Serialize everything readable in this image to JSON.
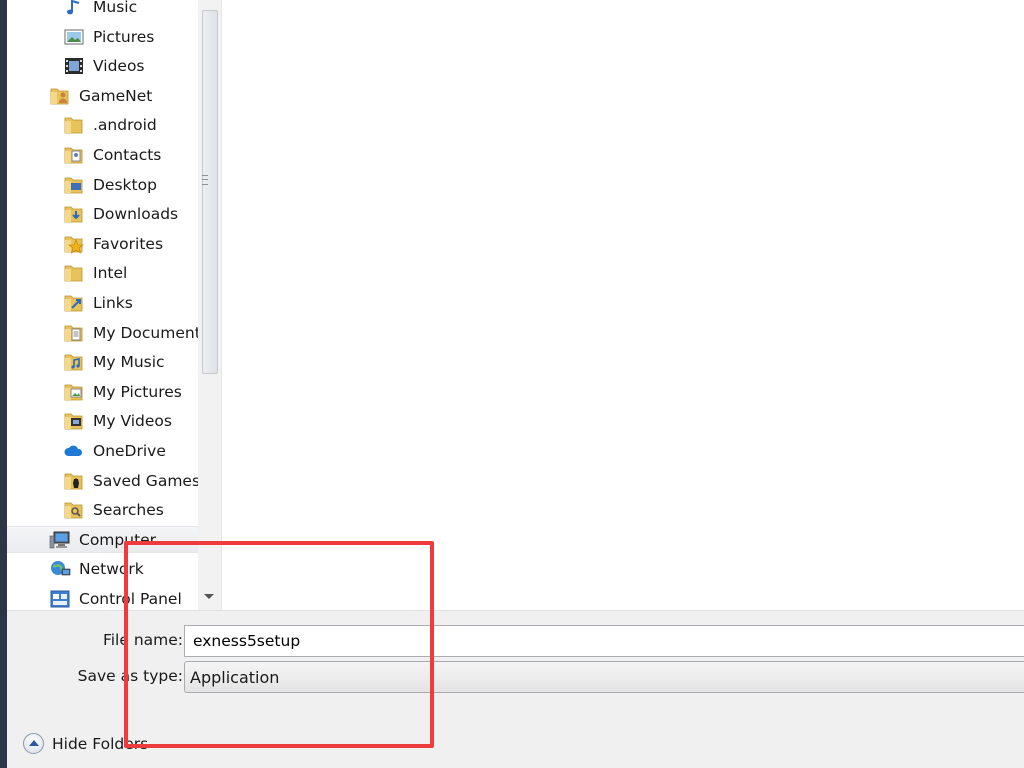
{
  "tree": {
    "items": [
      {
        "label": "Music",
        "icon": "music-library-icon",
        "level": 2,
        "selected": false
      },
      {
        "label": "Pictures",
        "icon": "pictures-library-icon",
        "level": 2,
        "selected": false
      },
      {
        "label": "Videos",
        "icon": "videos-library-icon",
        "level": 2,
        "selected": false
      },
      {
        "label": "GameNet",
        "icon": "user-folder-icon",
        "level": 1,
        "selected": false
      },
      {
        "label": ".android",
        "icon": "folder-icon",
        "level": 2,
        "selected": false
      },
      {
        "label": "Contacts",
        "icon": "contacts-folder-icon",
        "level": 2,
        "selected": false
      },
      {
        "label": "Desktop",
        "icon": "desktop-folder-icon",
        "level": 2,
        "selected": false
      },
      {
        "label": "Downloads",
        "icon": "downloads-folder-icon",
        "level": 2,
        "selected": false
      },
      {
        "label": "Favorites",
        "icon": "favorites-folder-icon",
        "level": 2,
        "selected": false
      },
      {
        "label": "Intel",
        "icon": "folder-icon",
        "level": 2,
        "selected": false
      },
      {
        "label": "Links",
        "icon": "links-folder-icon",
        "level": 2,
        "selected": false
      },
      {
        "label": "My Documents",
        "icon": "documents-folder-icon",
        "level": 2,
        "selected": false
      },
      {
        "label": "My Music",
        "icon": "music-folder-icon",
        "level": 2,
        "selected": false
      },
      {
        "label": "My Pictures",
        "icon": "pictures-folder-icon",
        "level": 2,
        "selected": false
      },
      {
        "label": "My Videos",
        "icon": "videos-folder-icon",
        "level": 2,
        "selected": false
      },
      {
        "label": "OneDrive",
        "icon": "onedrive-cloud-icon",
        "level": 2,
        "selected": false
      },
      {
        "label": "Saved Games",
        "icon": "saved-games-folder-icon",
        "level": 2,
        "selected": false
      },
      {
        "label": "Searches",
        "icon": "searches-folder-icon",
        "level": 2,
        "selected": false
      },
      {
        "label": "Computer",
        "icon": "computer-icon",
        "level": 1,
        "selected": true
      },
      {
        "label": "Network",
        "icon": "network-icon",
        "level": 1,
        "selected": false
      },
      {
        "label": "Control Panel",
        "icon": "control-panel-icon",
        "level": 1,
        "selected": false
      }
    ]
  },
  "form": {
    "filename_label": "File name:",
    "filename_value": "exness5setup",
    "savetype_label": "Save as type:",
    "savetype_value": "Application"
  },
  "footer": {
    "hide_folders_label": "Hide Folders"
  },
  "colors": {
    "highlight": "#ee3b3b",
    "folder": "#e8c25a",
    "accent": "#2c5aa0"
  }
}
